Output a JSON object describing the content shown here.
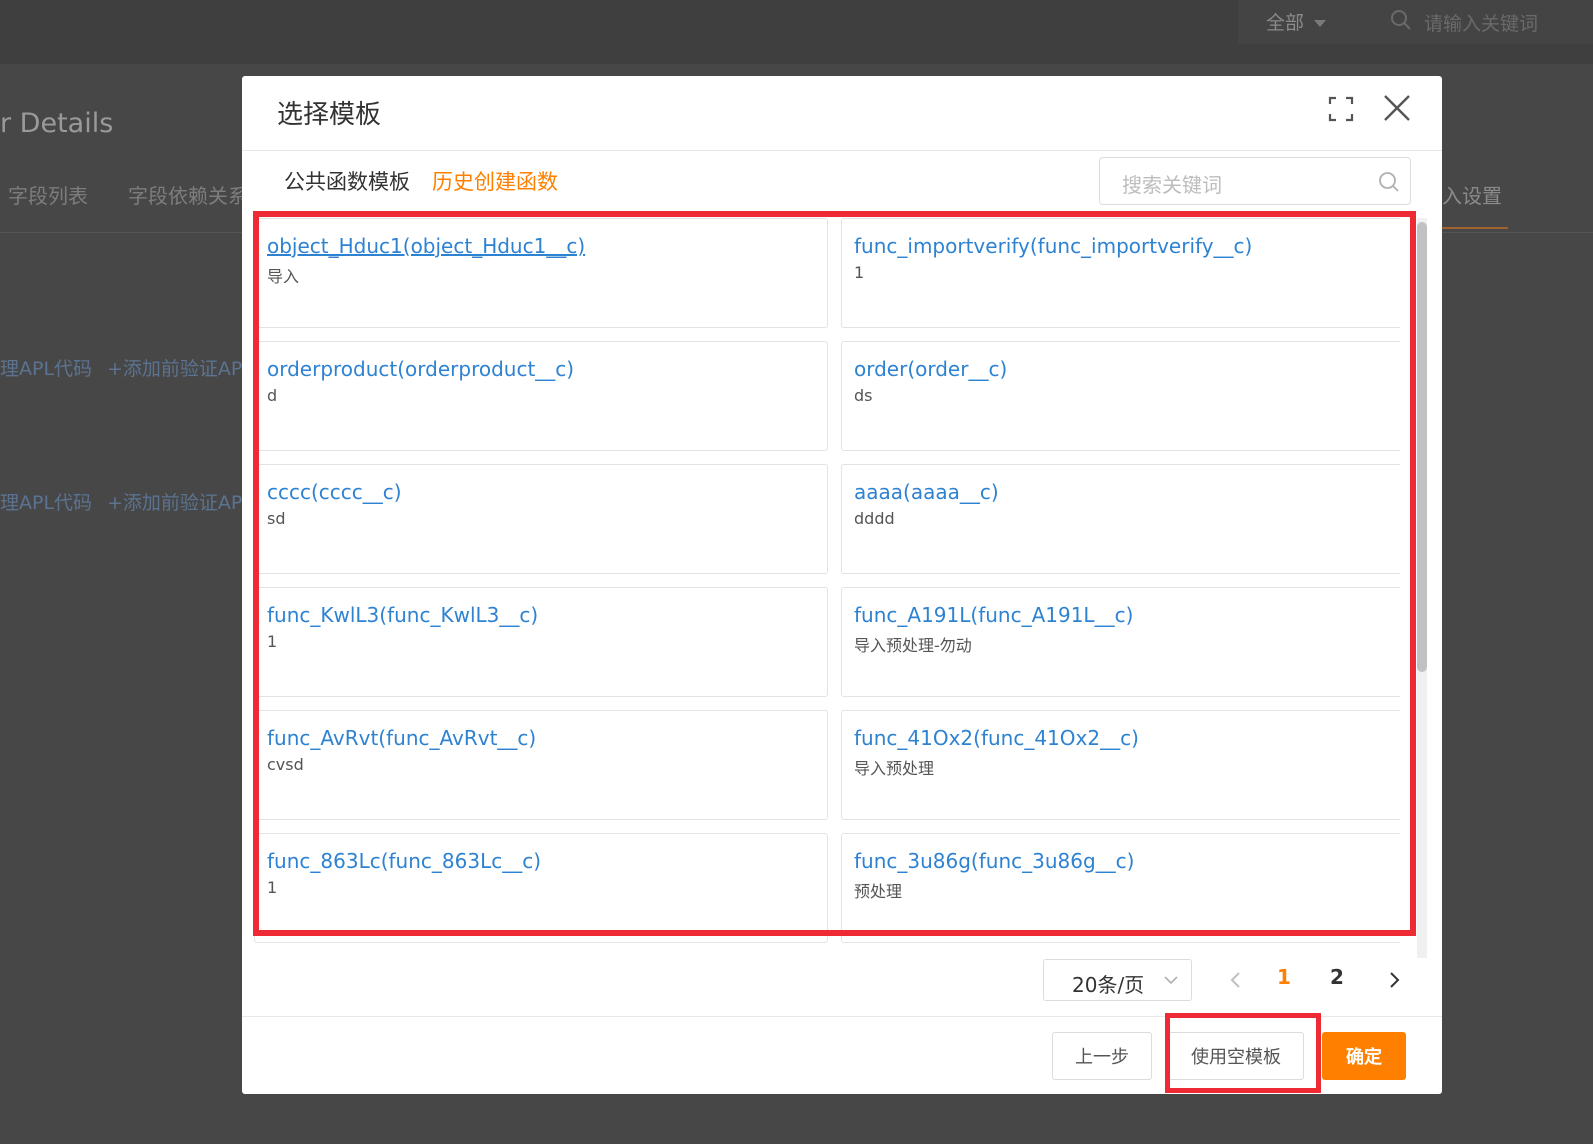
{
  "background": {
    "filter_select": "全部",
    "search_placeholder": "请输入关键词",
    "page_title": "r Details",
    "tabs": [
      "字段列表",
      "字段依赖关系"
    ],
    "tab_right": "入设置",
    "links": [
      "理APL代码",
      "+添加前验证APL"
    ]
  },
  "modal": {
    "title": "选择模板",
    "tabs": {
      "public": "公共函数模板",
      "history": "历史创建函数"
    },
    "search_placeholder": "搜索关键词",
    "cards": [
      {
        "name": "object_Hduc1(object_Hduc1__c)",
        "desc": "导入"
      },
      {
        "name": "func_importverify(func_importverify__c)",
        "desc": "1"
      },
      {
        "name": "orderproduct(orderproduct__c)",
        "desc": "d"
      },
      {
        "name": "order(order__c)",
        "desc": "ds"
      },
      {
        "name": "cccc(cccc__c)",
        "desc": "sd"
      },
      {
        "name": "aaaa(aaaa__c)",
        "desc": "dddd"
      },
      {
        "name": "func_KwlL3(func_KwlL3__c)",
        "desc": "1"
      },
      {
        "name": "func_A191L(func_A191L__c)",
        "desc": "导入预处理-勿动"
      },
      {
        "name": "func_AvRvt(func_AvRvt__c)",
        "desc": "cvsd"
      },
      {
        "name": "func_41Ox2(func_41Ox2__c)",
        "desc": "导入预处理"
      },
      {
        "name": "func_863Lc(func_863Lc__c)",
        "desc": "1"
      },
      {
        "name": "func_3u86g(func_3u86g__c)",
        "desc": "预处理"
      }
    ],
    "pagination": {
      "page_size": "20条/页",
      "pages": [
        "1",
        "2"
      ],
      "current_page": "1"
    },
    "footer": {
      "prev_label": "上一步",
      "empty_template_label": "使用空模板",
      "ok_label": "确定"
    }
  },
  "colors": {
    "accent": "#ff8000",
    "link": "#2e82d2",
    "highlight": "#ee2b35"
  }
}
